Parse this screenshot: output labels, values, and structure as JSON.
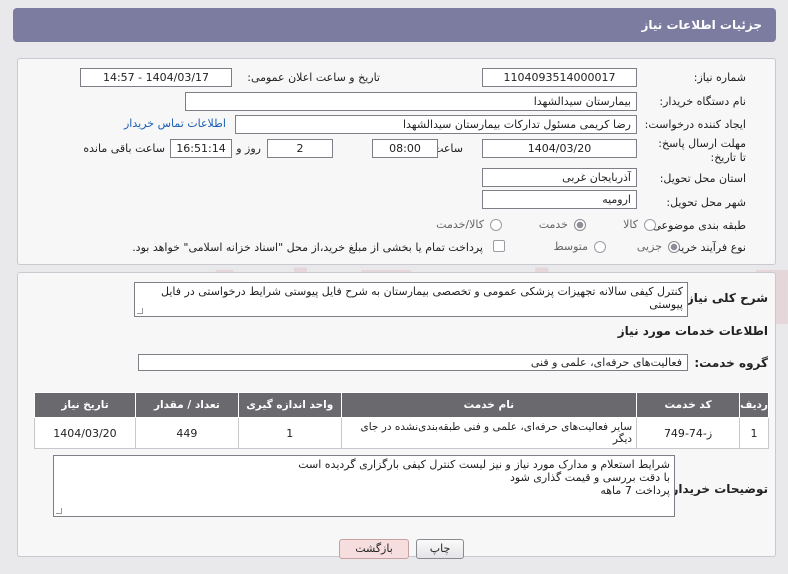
{
  "header": {
    "title": "جزئیات اطلاعات نیاز"
  },
  "form": {
    "need_number_label": "شماره نیاز:",
    "need_number": "1104093514000017",
    "announce_label": "تاریخ و ساعت اعلان عمومی:",
    "announce_value": "1404/03/17 - 14:57",
    "buyer_org_label": "نام دستگاه خریدار:",
    "buyer_org": "بیمارستان سیدالشهدا",
    "creator_label": "ایجاد کننده درخواست:",
    "creator": "رضا کریمی مسئول تدارکات بیمارستان سیدالشهدا",
    "contact_link": "اطلاعات تماس خریدار",
    "deadline_label": "مهلت ارسال پاسخ: تا تاریخ:",
    "deadline_date": "1404/03/20",
    "time_label": "ساعت",
    "deadline_time": "08:00",
    "days_value": "2",
    "days_label": "روز و",
    "remaining_time": "16:51:14",
    "remaining_label": "ساعت باقی مانده",
    "province_label": "استان محل تحویل:",
    "province": "آذربایجان غربی",
    "city_label": "شهر محل تحویل:",
    "city": "ارومیه",
    "category_label": "طبقه بندی موضوعی:",
    "category_options": [
      "کالا",
      "خدمت",
      "کالا/خدمت"
    ],
    "category_selected": 1,
    "process_label": "نوع فرآیند خرید :",
    "process_options": [
      "جزیی",
      "متوسط"
    ],
    "process_selected": 0,
    "treasury_note": "پرداخت تمام یا بخشی از مبلغ خرید،از محل \"اسناد خزانه اسلامی\" خواهد بود."
  },
  "description": {
    "label": "شرح کلی نیاز:",
    "text": "کنترل کیفی سالانه تجهیزات پزشکی عمومی و تخصصی بیمارستان به شرح فایل پیوستی شرایط درخواستی در فایل پیوستی"
  },
  "services": {
    "section_title": "اطلاعات خدمات مورد نیاز",
    "group_label": "گروه خدمت:",
    "group_value": "فعالیت‌های حرفه‌ای، علمی و فنی",
    "columns": [
      "ردیف",
      "کد خدمت",
      "نام خدمت",
      "واحد اندازه گیری",
      "تعداد / مقدار",
      "تاریخ نیاز"
    ],
    "rows": [
      {
        "row": "1",
        "code": "ز-74-749",
        "name": "سایر فعالیت‌های حرفه‌ای، علمی و فنی طبقه‌بندی‌نشده در جای دیگر",
        "unit": "1",
        "qty": "449",
        "date": "1404/03/20"
      }
    ]
  },
  "buyer_notes": {
    "label": "توضیحات خریدار:",
    "lines": [
      "شرایط استعلام و مدارک مورد نیاز و نیز لیست کنترل کیفی بارگزاری گردیده است",
      "با دقت بررسی و قیمت گذاری شود",
      "پرداخت 7 ماهه"
    ]
  },
  "buttons": {
    "print": "چاپ",
    "back": "بازگشت"
  },
  "watermark": "AriaTender.neT",
  "colors": {
    "header": "#7c7ba0",
    "table_header": "#6a6a6e",
    "link": "#1a5fb4",
    "back_button": "#f7dede"
  }
}
